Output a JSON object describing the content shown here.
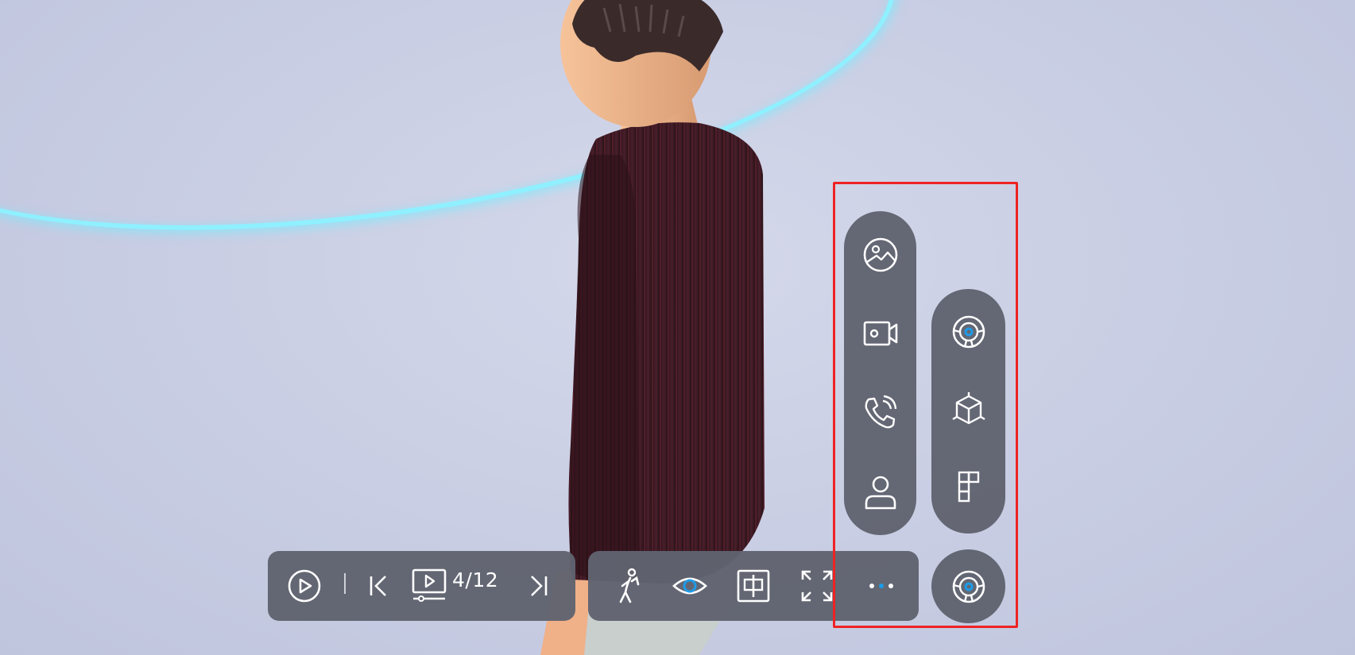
{
  "playback": {
    "slide_counter": "4/12"
  },
  "icons": {
    "play": "play-circle-icon",
    "prev": "skip-back-icon",
    "slides": "presentation-icon",
    "next": "skip-forward-icon",
    "walk": "walk-person-icon",
    "view": "eye-icon",
    "center": "zhong-center-icon",
    "fullscreen": "fullscreen-icon",
    "more": "more-dots-icon",
    "picture": "image-icon",
    "camera": "video-camera-icon",
    "call": "phone-call-icon",
    "person": "user-icon",
    "steering_top": "steering-wheel-icon",
    "model3d": "cube-3d-icon",
    "layout": "grid-layout-icon",
    "steering_bottom": "steering-wheel-icon"
  },
  "colors": {
    "panel": "#606370",
    "accent": "#1e9be8",
    "highlight": "#ee2323",
    "halo": "#8ff0ff"
  }
}
